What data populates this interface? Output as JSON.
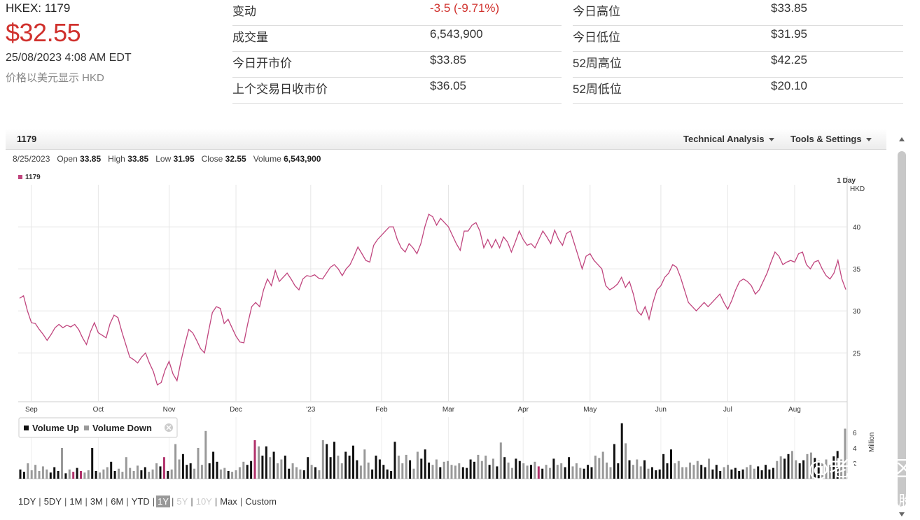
{
  "quote": {
    "ticker": "HKEX: 1179",
    "price": "$32.55",
    "timestamp": "25/08/2023 4:08 AM EDT",
    "currency_note": "价格以美元显示 HKD"
  },
  "stats_left": [
    {
      "label": "变动",
      "value": "-3.5 (-9.71%)",
      "negative": true
    },
    {
      "label": "成交量",
      "value": "6,543,900"
    },
    {
      "label": "今日开市价",
      "value": "$33.85"
    },
    {
      "label": "上个交易日收市价",
      "value": "$36.05"
    }
  ],
  "stats_right": [
    {
      "label": "今日高位",
      "value": "$33.85"
    },
    {
      "label": "今日低位",
      "value": "$31.95"
    },
    {
      "label": "52周高位",
      "value": "$42.25"
    },
    {
      "label": "52周低位",
      "value": "$20.10"
    }
  ],
  "chart_header": {
    "symbol": "1179",
    "technical_label": "Technical Analysis",
    "tools_label": "Tools & Settings"
  },
  "ohlc": {
    "date": "8/25/2023",
    "open_label": "Open",
    "open": "33.85",
    "high_label": "High",
    "high": "33.85",
    "low_label": "Low",
    "low": "31.95",
    "close_label": "Close",
    "close": "32.55",
    "volume_label": "Volume",
    "volume": "6,543,900"
  },
  "ranges": [
    {
      "label": "1DY"
    },
    {
      "label": "5DY"
    },
    {
      "label": "1M"
    },
    {
      "label": "3M"
    },
    {
      "label": "6M"
    },
    {
      "label": "YTD"
    },
    {
      "label": "1Y",
      "selected": true
    },
    {
      "label": "5Y",
      "disabled": true
    },
    {
      "label": "10Y",
      "disabled": true
    },
    {
      "label": "Max"
    },
    {
      "label": "Custom"
    }
  ],
  "watermark": {
    "line1": "@老虎社区",
    "line2": "@涛哥讲股"
  },
  "colors": {
    "price_line": "#c0457e",
    "negative": "#d0312d",
    "vol_up": "#111111",
    "vol_down": "#999999",
    "vol_highlight": "#b0306a"
  },
  "chart_data": [
    {
      "type": "line",
      "series": [
        {
          "name": "1179",
          "values": [
            31.5,
            31.8,
            30.0,
            28.6,
            28.5,
            27.8,
            27.2,
            26.5,
            27.2,
            28.0,
            28.4,
            28.0,
            28.3,
            28.1,
            28.4,
            27.8,
            26.8,
            26.0,
            27.5,
            28.6,
            27.4,
            27.1,
            26.8,
            28.5,
            29.5,
            29.2,
            27.5,
            26.0,
            24.5,
            24.2,
            23.8,
            24.5,
            25.0,
            23.8,
            22.8,
            21.2,
            21.5,
            23.0,
            24.0,
            22.5,
            21.7,
            24.0,
            26.0,
            27.8,
            27.4,
            26.5,
            25.5,
            25.0,
            27.5,
            29.8,
            30.5,
            30.3,
            28.5,
            29.0,
            28.0,
            27.0,
            26.3,
            26.2,
            28.5,
            30.5,
            31.0,
            30.5,
            32.5,
            33.8,
            33.0,
            34.8,
            33.5,
            34.0,
            34.5,
            33.8,
            33.0,
            32.5,
            33.8,
            34.2,
            34.1,
            34.3,
            33.9,
            33.8,
            34.5,
            35.2,
            35.5,
            35.0,
            34.2,
            35.0,
            35.5,
            36.5,
            37.6,
            36.8,
            36.0,
            35.8,
            37.8,
            38.5,
            39.0,
            39.5,
            40.0,
            40.0,
            38.5,
            37.5,
            37.0,
            38.0,
            37.5,
            36.8,
            38.0,
            40.0,
            41.5,
            41.2,
            40.2,
            41.0,
            40.5,
            40.0,
            39.0,
            38.0,
            37.2,
            39.5,
            39.5,
            40.2,
            40.5,
            39.5,
            37.5,
            38.5,
            37.5,
            38.5,
            37.5,
            38.8,
            38.2,
            37.0,
            38.2,
            39.5,
            38.5,
            37.8,
            38.0,
            37.5,
            38.5,
            39.5,
            38.8,
            38.0,
            39.6,
            38.5,
            37.8,
            39.2,
            39.5,
            38.0,
            36.5,
            35.0,
            36.5,
            36.8,
            36.0,
            35.5,
            35.0,
            33.0,
            32.5,
            32.8,
            33.2,
            34.0,
            32.8,
            33.5,
            32.0,
            30.0,
            29.5,
            30.5,
            29.0,
            31.0,
            32.5,
            33.0,
            34.0,
            34.5,
            35.5,
            35.2,
            34.0,
            32.5,
            31.0,
            30.5,
            30.0,
            30.5,
            31.0,
            30.5,
            31.0,
            31.5,
            32.0,
            31.0,
            30.2,
            31.2,
            32.5,
            33.5,
            33.8,
            33.5,
            33.0,
            32.0,
            32.5,
            33.5,
            34.5,
            35.8,
            37.0,
            36.5,
            35.5,
            35.8,
            36.0,
            35.8,
            36.8,
            37.0,
            35.5,
            35.0,
            35.8,
            36.0,
            35.0,
            34.2,
            33.8,
            34.5,
            36.0,
            33.8,
            32.55
          ]
        }
      ],
      "x_ticks": [
        "Sep",
        "Oct",
        "Nov",
        "Dec",
        "'23",
        "Feb",
        "Mar",
        "Apr",
        "May",
        "Jun",
        "Jul",
        "Aug"
      ],
      "y_ticks": [
        25,
        30,
        35,
        40
      ],
      "ylim": [
        19.2,
        45
      ],
      "ylabel": "HKD",
      "interval_label": "1 Day",
      "legend": "1179",
      "grid": true
    },
    {
      "type": "bar",
      "series": [
        {
          "name": "Volume",
          "values": [
            1.2,
            0.9,
            2.0,
            1.1,
            1.8,
            1.0,
            1.6,
            1.2,
            0.8,
            1.5,
            1.0,
            4.0,
            0.7,
            1.2,
            0.9,
            1.4,
            1.0,
            0.8,
            1.1,
            4.0,
            1.0,
            0.8,
            1.2,
            1.5,
            2.2,
            1.0,
            1.3,
            0.9,
            2.8,
            1.4,
            1.0,
            1.7,
            1.1,
            1.5,
            0.9,
            1.2,
            2.0,
            1.6,
            2.8,
            1.0,
            1.2,
            4.5,
            2.5,
            3.2,
            1.8,
            2.0,
            1.3,
            4.0,
            1.8,
            6.2,
            2.0,
            3.5,
            2.2,
            1.2,
            1.4,
            1.0,
            0.9,
            1.1,
            1.5,
            2.2,
            1.8,
            2.3,
            5.0,
            4.2,
            3.0,
            4.2,
            2.8,
            3.5,
            2.0,
            2.5,
            3.0,
            1.3,
            2.0,
            1.5,
            1.2,
            1.1,
            2.8,
            1.8,
            1.5,
            1.1,
            5.0,
            4.5,
            2.8,
            4.8,
            3.0,
            2.0,
            3.5,
            3.0,
            4.3,
            2.4,
            1.7,
            3.8,
            2.1,
            1.2,
            3.0,
            2.5,
            1.8,
            1.2,
            1.0,
            4.8,
            3.0,
            2.0,
            3.1,
            2.4,
            1.3,
            3.5,
            2.6,
            3.8,
            2.1,
            1.8,
            2.5,
            1.5,
            2.2,
            2.3,
            1.8,
            1.7,
            2.0,
            1.5,
            1.4,
            2.5,
            2.2,
            3.1,
            2.3,
            3.0,
            1.8,
            2.6,
            1.6,
            4.7,
            2.8,
            2.1,
            1.4,
            2.6,
            2.3,
            2.0,
            1.7,
            1.8,
            2.2,
            1.6,
            1.3,
            1.8,
            1.4,
            2.6,
            1.8,
            2.0,
            1.5,
            2.8,
            1.6,
            2.0,
            1.4,
            1.3,
            1.8,
            1.5,
            3.0,
            2.7,
            3.5,
            2.1,
            1.5,
            4.5,
            2.0,
            7.2,
            4.6,
            2.4,
            1.8,
            2.5,
            1.6,
            2.4,
            1.3,
            1.5,
            1.1,
            1.2,
            3.2,
            2.0,
            3.8,
            2.0,
            2.3,
            1.5,
            1.5,
            2.1,
            1.8,
            2.3,
            1.8,
            1.5,
            2.6,
            1.2,
            1.8,
            1.0,
            1.5,
            1.8,
            1.2,
            1.4,
            1.0,
            1.2,
            1.5,
            1.8,
            1.3,
            1.6,
            1.1,
            1.8,
            1.2,
            1.4,
            2.3,
            2.9,
            2.6,
            3.2,
            3.6,
            2.4,
            2.0,
            2.4,
            3.2,
            3.4,
            2.7,
            2.3,
            2.0,
            2.5,
            1.8,
            2.9,
            3.6,
            2.5,
            6.5
          ]
        }
      ],
      "ylim": [
        0,
        8
      ],
      "y_ticks": [
        2,
        4,
        6
      ],
      "ylabel": "Million",
      "legend": [
        "Volume Up",
        "Volume Down"
      ]
    }
  ]
}
